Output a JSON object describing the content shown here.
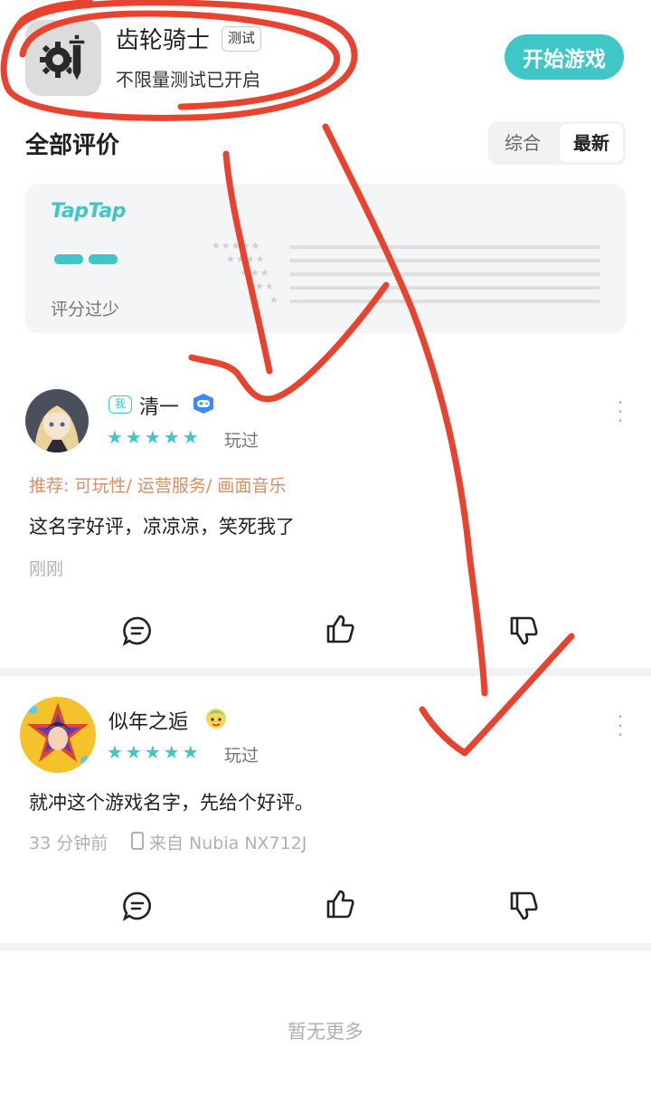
{
  "app": {
    "name": "齿轮骑士",
    "badge": "测试",
    "subtitle": "不限量测试已开启",
    "play_button": "开始游戏",
    "icon": "gear-sword-icon"
  },
  "reviews_section": {
    "title": "全部评价",
    "sort_options": [
      "综合",
      "最新"
    ],
    "selected_sort": "最新"
  },
  "rating": {
    "logo": "TapTap",
    "score_placeholder": "– –",
    "note": "评分过少",
    "accent": "#3fc6c6"
  },
  "reviews": [
    {
      "me_tag": "我",
      "user": "清一",
      "stars": "★★★★★",
      "played": "玩过",
      "tags": "推荐: 可玩性/ 运营服务/ 画面音乐",
      "text": "这名字好评，凉凉凉，笑死我了",
      "meta": "刚刚"
    },
    {
      "user": "似年之逅",
      "stars": "★★★★★",
      "played": "玩过",
      "text": "就冲这个游戏名字，先给个好评。",
      "time": "33 分钟前",
      "device": "来自 Nubia NX712J"
    }
  ],
  "footer": {
    "no_more": "暂无更多"
  },
  "colors": {
    "accent": "#3fc6c6",
    "annotation": "#e8432e",
    "tag_orange": "#e58a5f"
  }
}
